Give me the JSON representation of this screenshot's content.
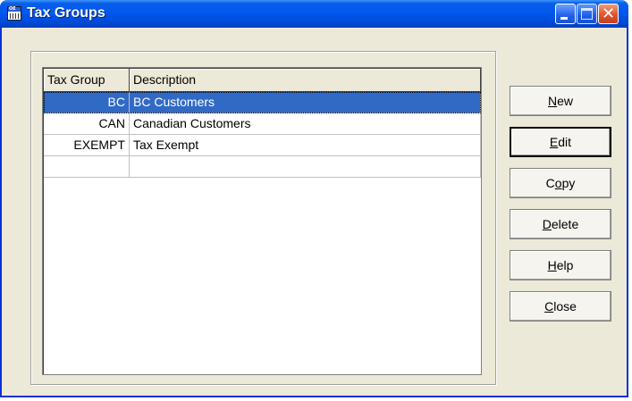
{
  "window": {
    "title": "Tax Groups",
    "icon": "oe-app-icon",
    "icon_text": "OE"
  },
  "grid": {
    "columns": [
      "Tax Group",
      "Description"
    ],
    "rows": [
      {
        "group": "BC",
        "description": "BC Customers",
        "selected": true
      },
      {
        "group": "CAN",
        "description": "Canadian Customers",
        "selected": false
      },
      {
        "group": "EXEMPT",
        "description": "Tax Exempt",
        "selected": false
      },
      {
        "group": "",
        "description": "",
        "selected": false
      }
    ]
  },
  "buttons": {
    "new": {
      "mnemonic": "N",
      "rest": "ew"
    },
    "edit": {
      "mnemonic": "E",
      "rest": "dit"
    },
    "copy": {
      "pre": "C",
      "mnemonic": "o",
      "rest": "py"
    },
    "delete": {
      "mnemonic": "D",
      "rest": "elete"
    },
    "help": {
      "mnemonic": "H",
      "rest": "elp"
    },
    "close": {
      "mnemonic": "C",
      "rest": "lose"
    }
  },
  "colors": {
    "titlebar": "#0058ee",
    "selection": "#316ac5",
    "face": "#ece9d8"
  }
}
